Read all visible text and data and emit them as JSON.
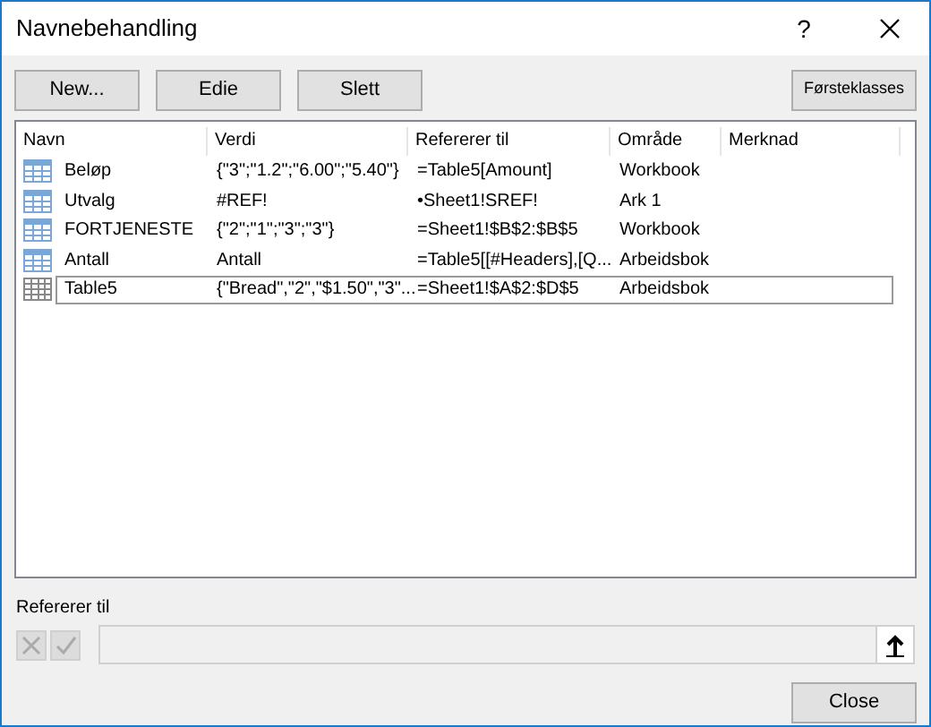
{
  "window": {
    "title": "Navnebehandling",
    "help": "?"
  },
  "toolbar": [
    "New...",
    "Edie",
    "Slett"
  ],
  "filter_button": "Førsteklasses",
  "table": {
    "columns": [
      "Navn",
      "Verdi",
      "Refererer til",
      "Område",
      "Merknad"
    ],
    "rows": [
      {
        "kind": "name",
        "selected": false,
        "cells": [
          "Beløp",
          "{\"3\";\"1.2\";\"6.00\";\"5.40\"}",
          "=Table5[Amount]",
          "Workbook"
        ]
      },
      {
        "kind": "name",
        "selected": false,
        "cells": [
          "Utvalg",
          "#REF!",
          "•Sheet1!SREF!",
          "Ark 1"
        ]
      },
      {
        "kind": "name",
        "selected": false,
        "cells": [
          "FORTJENESTE",
          "{\"2\";\"1\";\"3\";\"3\"}",
          "=Sheet1!$B$2:$B$5",
          "Workbook"
        ]
      },
      {
        "kind": "name",
        "selected": false,
        "cells": [
          "Antall",
          "Antall",
          "=Table5[[#Headers],[Q...",
          "Arbeidsbok"
        ]
      },
      {
        "kind": "table",
        "selected": true,
        "cells": [
          "Table5",
          "{\"Bread\",\"2\",\"$1.50\",\"3\"...",
          "=Sheet1!$A$2:$D$5",
          "Arbeidsbok"
        ]
      }
    ]
  },
  "refers_to": {
    "label": "Refererer til"
  },
  "close_button": "Close"
}
